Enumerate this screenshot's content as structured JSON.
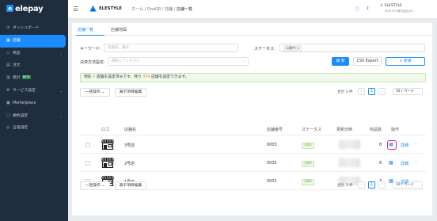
{
  "sidebar": {
    "logo": "elepay",
    "items": [
      {
        "label": "ダッシュボード",
        "icon": "dashboard-icon",
        "active": false,
        "chevron": false
      },
      {
        "label": "店舗",
        "icon": "store-icon",
        "active": true,
        "chevron": false
      },
      {
        "label": "商品",
        "icon": "tag-icon",
        "active": false,
        "chevron": true
      },
      {
        "label": "注文",
        "icon": "order-icon",
        "active": false,
        "chevron": false
      },
      {
        "label": "統計",
        "icon": "chart-icon",
        "active": false,
        "chevron": false,
        "badge": "BETA"
      },
      {
        "label": "サービス設定",
        "icon": "gear-icon",
        "active": false,
        "chevron": true
      },
      {
        "label": "Marketplace",
        "icon": "grid-icon",
        "active": false,
        "chevron": false
      },
      {
        "label": "規約設定",
        "icon": "document-icon",
        "active": false,
        "chevron": true
      },
      {
        "label": "言語設定",
        "icon": "globe-icon",
        "active": false,
        "chevron": false
      }
    ]
  },
  "topbar": {
    "brand": "ELESTYLE",
    "breadcrumb": [
      "ホーム",
      "OneQR",
      "店舗",
      "店舗一覧"
    ],
    "user_name": "ELESTYLE",
    "user_sub": "ELESTYLE株式会社(et..."
  },
  "tabs": [
    {
      "label": "店舗一覧",
      "active": true
    },
    {
      "label": "店舗地図",
      "active": false
    }
  ],
  "filters": {
    "keyword_label": "キーワード:",
    "keyword_placeholder": "店舗名、番号",
    "status_label": "ステータス:",
    "status_tag": "公開中 ×",
    "payment_label": "決済方法設定:",
    "payment_placeholder": "選択してください",
    "search_button": "検 索",
    "export_button": "CSV Export",
    "new_button": "+ 新規"
  },
  "notice": {
    "pre": "現在 ",
    "count_used": "6",
    "mid": " 店舗を設定済みです。残り ",
    "count_left": "994",
    "post": " 店舗を設定できます。"
  },
  "toolbar": {
    "bulk_label": "一括操作",
    "columns_label": "表示項目編集",
    "total": "合計 3 件",
    "page": "1",
    "page_size": "10 / ページ"
  },
  "table": {
    "headers": [
      "ロゴ",
      "店舗名",
      "店舗番号",
      "ステータス",
      "更新日時",
      "商品数",
      "操作"
    ],
    "rows": [
      {
        "name": "3号店",
        "number": "0003",
        "status": "公開中",
        "products": "8",
        "detail": "詳細",
        "more": "···"
      },
      {
        "name": "2号店",
        "number": "0002",
        "status": "公開中",
        "products": "8",
        "detail": "詳細",
        "more": "···"
      },
      {
        "name": "1号店",
        "number": "0001",
        "status": "公開中",
        "products": "3",
        "detail": "詳細",
        "more": "···"
      }
    ]
  },
  "colors": {
    "primary": "#1a8cff",
    "sidebar": "#1f2d3d",
    "success": "#67c23a",
    "highlight": "#e0245e"
  }
}
